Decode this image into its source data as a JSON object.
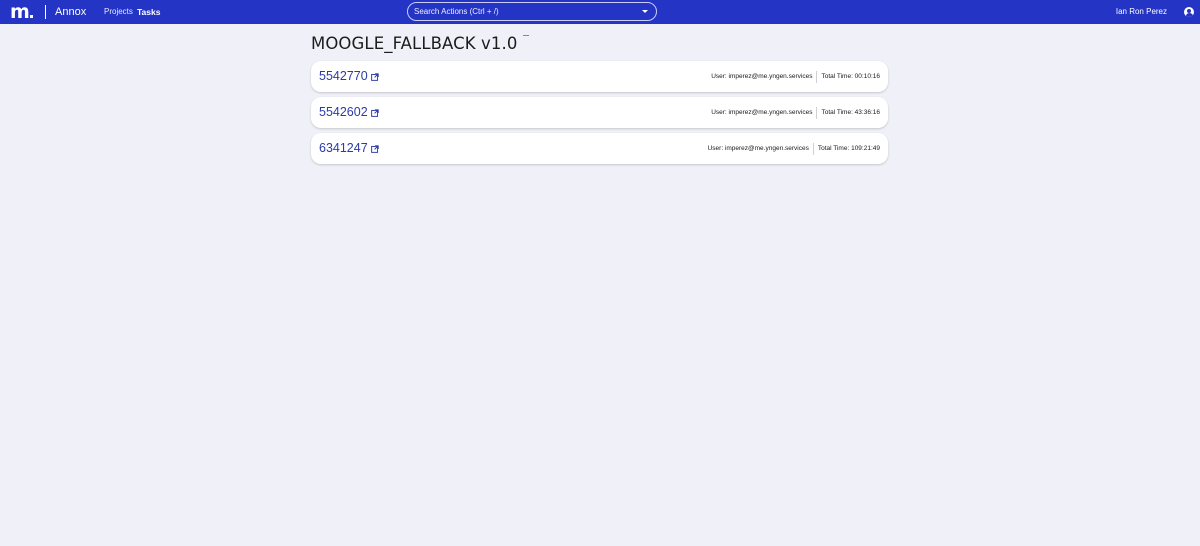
{
  "topbar": {
    "logo_text": "m",
    "brand": "Annox",
    "nav": {
      "projects": "Projects",
      "tasks": "Tasks"
    },
    "search_placeholder": "Search Actions (Ctrl + /)",
    "user_name": "Ian Ron Perez",
    "bar_color": "#2434c4"
  },
  "page": {
    "title": "MOOGLE_FALLBACK v1.0"
  },
  "tasks": [
    {
      "id": "5542770",
      "user": "User: imperez@me.yngen.services",
      "total_time": "Total Time: 00:10:16"
    },
    {
      "id": "5542602",
      "user": "User: imperez@me.yngen.services",
      "total_time": "Total Time: 43:36:16"
    },
    {
      "id": "6341247",
      "user": "User: imperez@me.yngen.services",
      "total_time": "Total Time: 109:21:49"
    }
  ],
  "icons": {
    "task_link": "external-link-icon",
    "user": "account-circle-icon",
    "search": "chevron-down-icon"
  }
}
